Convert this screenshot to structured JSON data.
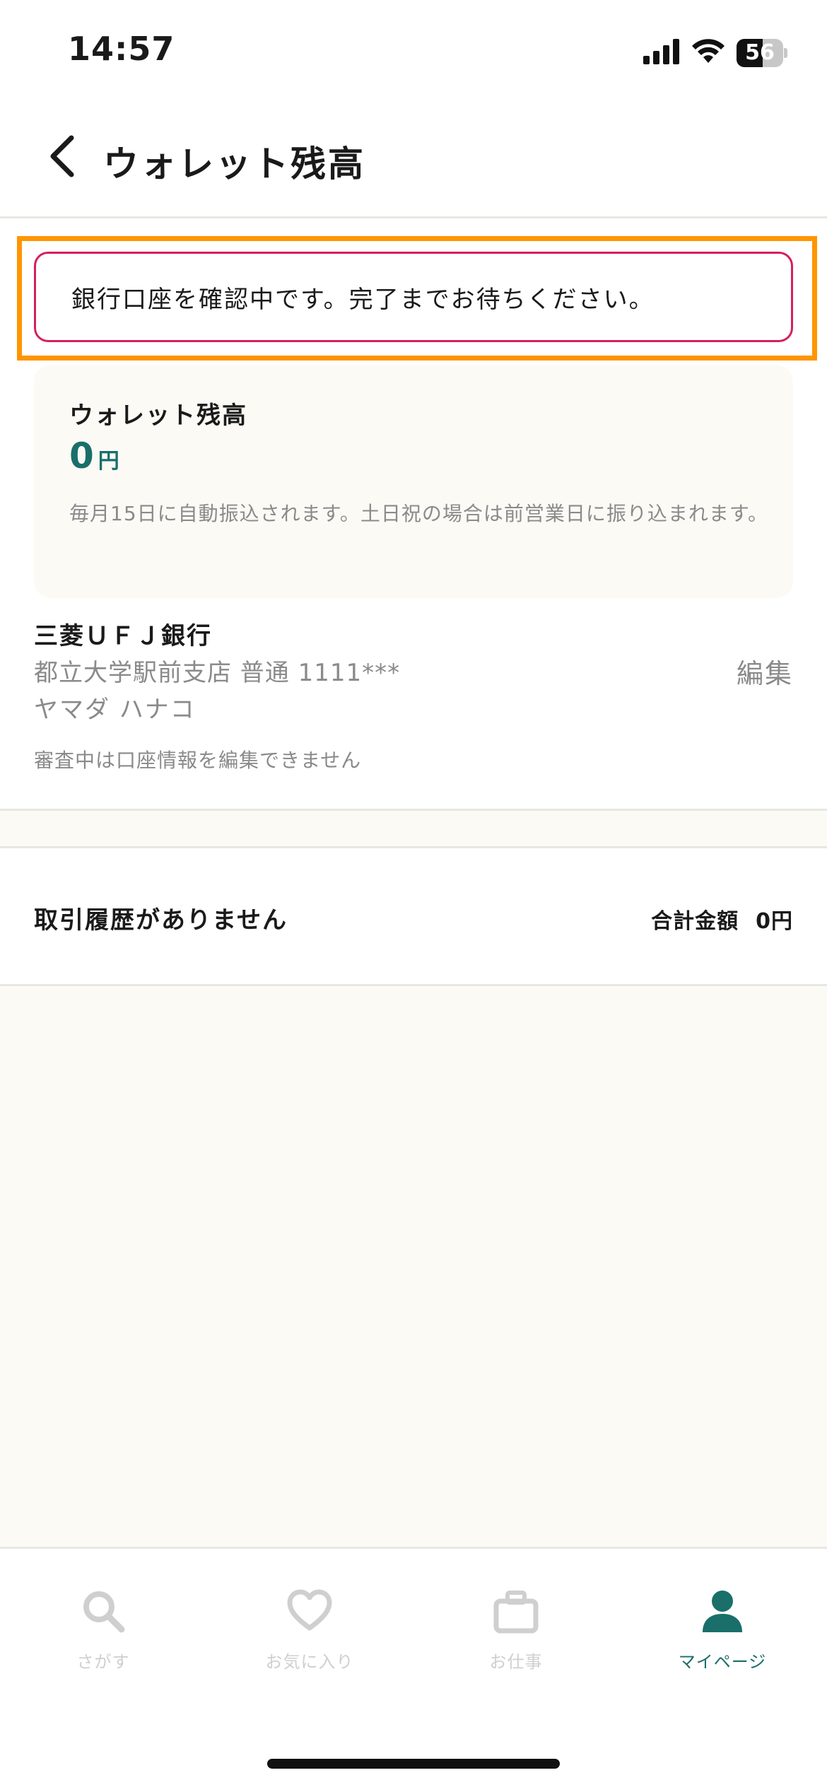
{
  "status_bar": {
    "time": "14:57",
    "battery_level": 56,
    "battery_text": "56"
  },
  "header": {
    "title": "ウォレット残高"
  },
  "notice": {
    "message": "銀行口座を確認中です。完了までお待ちください。",
    "border_color": "#d61f5e",
    "highlight_color": "#ff9500"
  },
  "wallet": {
    "label": "ウォレット残高",
    "amount": "0",
    "unit": "円",
    "note": "毎月15日に自動振込されます。土日祝の場合は前営業日に振り込まれます。",
    "accent_color": "#1a6f6a"
  },
  "bank": {
    "name": "三菱ＵＦＪ銀行",
    "branch_account": "都立大学駅前支店 普通 1111***",
    "holder": "ヤマダ ハナコ",
    "edit_label": "編集",
    "lock_note": "審査中は口座情報を編集できません"
  },
  "history": {
    "empty_text": "取引履歴がありません",
    "total_label": "合計金額",
    "total_value": "0円"
  },
  "tab_bar": {
    "tabs": [
      {
        "label": "さがす",
        "icon": "search-icon",
        "active": false
      },
      {
        "label": "お気に入り",
        "icon": "heart-icon",
        "active": false
      },
      {
        "label": "お仕事",
        "icon": "briefcase-icon",
        "active": false
      },
      {
        "label": "マイページ",
        "icon": "person-icon",
        "active": true
      }
    ],
    "inactive_color": "#cfcfcf",
    "active_color": "#1a6f6a"
  }
}
